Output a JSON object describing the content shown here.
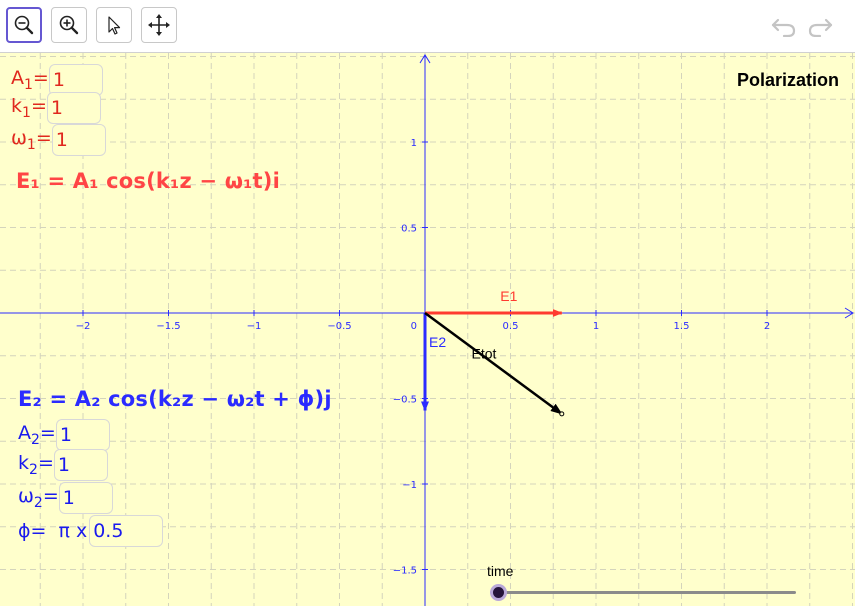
{
  "toolbar": {
    "tools": [
      {
        "id": "zoom-out",
        "icon": "zoom-out-icon",
        "active": true
      },
      {
        "id": "zoom-in",
        "icon": "zoom-in-icon",
        "active": false
      },
      {
        "id": "move",
        "icon": "pointer-arrow-icon",
        "active": false
      },
      {
        "id": "move-view",
        "icon": "move-view-icon",
        "active": false
      }
    ],
    "undo_icon": "undo-icon",
    "redo_icon": "redo-icon"
  },
  "title": "Polarization",
  "wave1": {
    "color": "#e0281e",
    "A": {
      "label": "A",
      "sub": "1",
      "value": "1"
    },
    "k": {
      "label": "k",
      "sub": "1",
      "value": "1"
    },
    "omega": {
      "label": "ω",
      "sub": "1",
      "value": "1"
    },
    "formula": "E₁ = A₁ cos(k₁z − ω₁t)i"
  },
  "wave2": {
    "color": "#1a1aee",
    "formula": "E₂ = A₂ cos(k₂z − ω₂t + ϕ)j",
    "A": {
      "label": "A",
      "sub": "2",
      "value": "1"
    },
    "k": {
      "label": "k",
      "sub": "2",
      "value": "1"
    },
    "omega": {
      "label": "ω",
      "sub": "2",
      "value": "1"
    },
    "phi": {
      "label": "ϕ=",
      "mult": "π x",
      "value": "0.5"
    }
  },
  "graph": {
    "axis_color": "#2b2bff",
    "x_ticks": [
      {
        "v": -2,
        "t": "−2"
      },
      {
        "v": -1.5,
        "t": "−1.5"
      },
      {
        "v": -1,
        "t": "−1"
      },
      {
        "v": -0.5,
        "t": "−0.5"
      },
      {
        "v": 0.5,
        "t": "0.5"
      },
      {
        "v": 1,
        "t": "1"
      },
      {
        "v": 1.5,
        "t": "1.5"
      },
      {
        "v": 2,
        "t": "2"
      }
    ],
    "y_ticks": [
      {
        "v": 1,
        "t": "1"
      },
      {
        "v": 0.5,
        "t": "0.5"
      },
      {
        "v": -0.5,
        "t": "−0.5"
      },
      {
        "v": -1,
        "t": "−1"
      },
      {
        "v": -1.5,
        "t": "−1.5"
      }
    ],
    "origin_label": "0",
    "vectors": [
      {
        "name": "E1",
        "label": "E1",
        "dx": 0.8,
        "dy": 0,
        "color": "#ff3b30"
      },
      {
        "name": "E2",
        "label": "E2",
        "dx": 0,
        "dy": -0.57,
        "color": "#2b2bff"
      },
      {
        "name": "Etot",
        "label": "Etot",
        "dx": 0.8,
        "dy": -0.59,
        "color": "#000000"
      }
    ]
  },
  "slider": {
    "label": "time",
    "value": 0
  }
}
